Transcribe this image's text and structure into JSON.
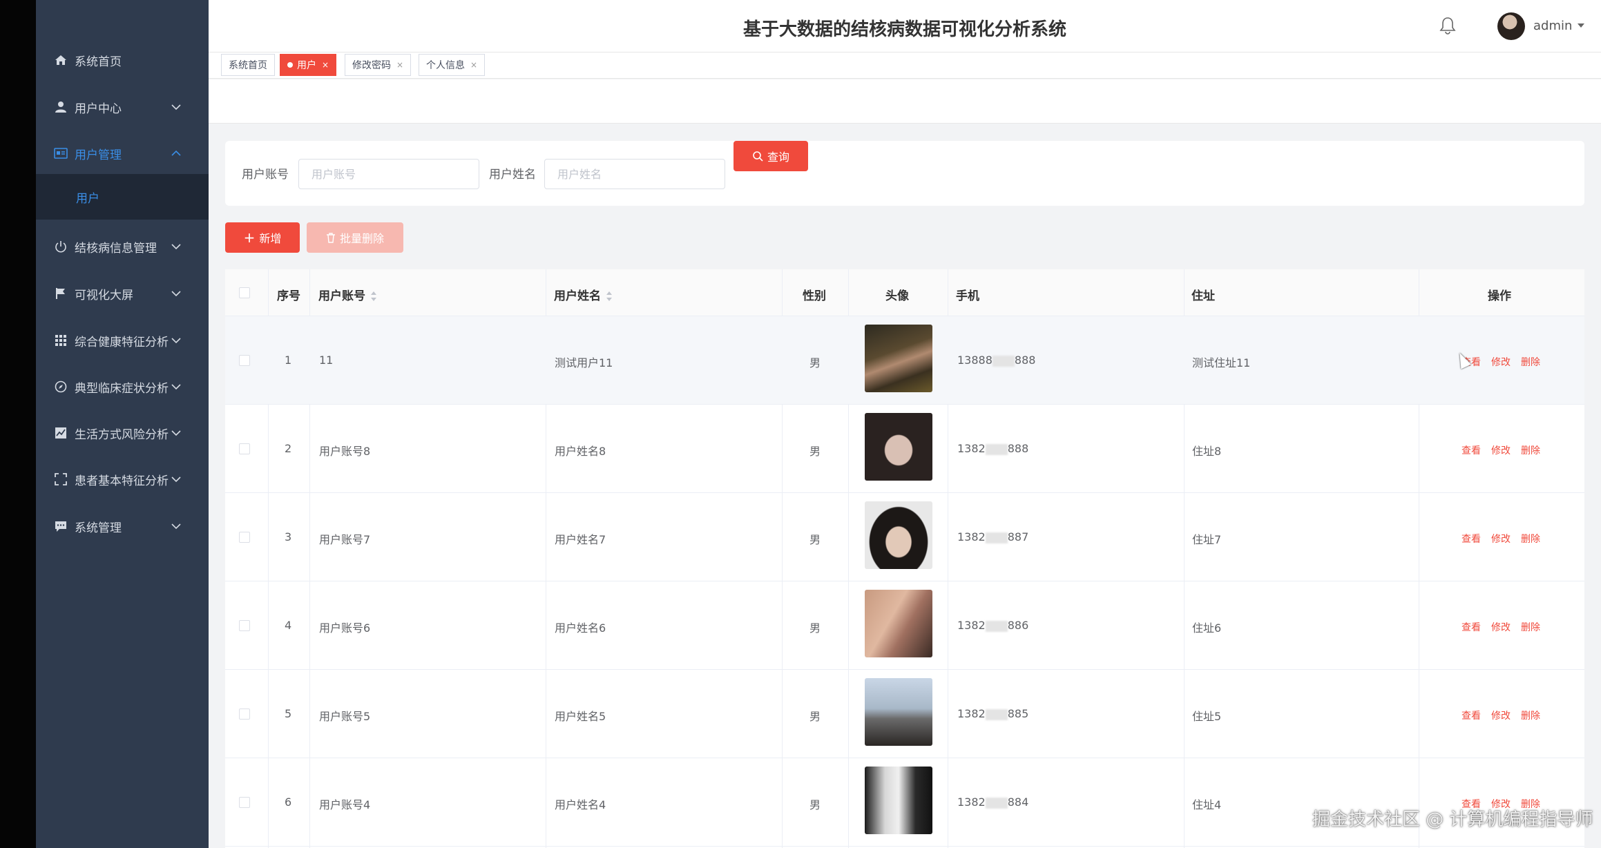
{
  "app": {
    "title": "基于大数据的结核病数据可视化分析系统",
    "user": "admin",
    "accent": "#f04a3c"
  },
  "sidebar": {
    "items": [
      {
        "label": "系统首页",
        "icon": "home-icon"
      },
      {
        "label": "用户中心",
        "icon": "user-icon"
      },
      {
        "label": "用户管理",
        "icon": "id-card-icon"
      },
      {
        "label": "结核病信息管理",
        "icon": "power-icon"
      },
      {
        "label": "可视化大屏",
        "icon": "flag-icon"
      },
      {
        "label": "综合健康特征分析",
        "icon": "grid-icon"
      },
      {
        "label": "典型临床症状分析",
        "icon": "compass-icon"
      },
      {
        "label": "生活方式风险分析",
        "icon": "chart-icon"
      },
      {
        "label": "患者基本特征分析",
        "icon": "fullscreen-icon"
      },
      {
        "label": "系统管理",
        "icon": "message-icon"
      }
    ],
    "sub_item": "用户"
  },
  "tabs": [
    {
      "label": "系统首页"
    },
    {
      "label": "用户",
      "close": "×"
    },
    {
      "label": "修改密码",
      "close": "×"
    },
    {
      "label": "个人信息",
      "close": "×"
    }
  ],
  "search": {
    "account_label": "用户账号",
    "account_placeholder": "用户账号",
    "name_label": "用户姓名",
    "name_placeholder": "用户姓名",
    "query_button": "查询"
  },
  "actions": {
    "add": "新增",
    "batch_delete": "批量删除"
  },
  "table": {
    "headers": {
      "index": "序号",
      "account": "用户账号",
      "name": "用户姓名",
      "gender": "性别",
      "avatar": "头像",
      "phone": "手机",
      "address": "住址",
      "ops": "操作"
    },
    "op_labels": {
      "view": "查看",
      "edit": "修改",
      "delete": "删除"
    },
    "rows": [
      {
        "index": "1",
        "account": "11",
        "name": "测试用户11",
        "gender": "男",
        "phone_prefix": "13888",
        "phone_suffix": "888",
        "address": "测试住址11"
      },
      {
        "index": "2",
        "account": "用户账号8",
        "name": "用户姓名8",
        "gender": "男",
        "phone_prefix": "1382",
        "phone_suffix": "888",
        "address": "住址8"
      },
      {
        "index": "3",
        "account": "用户账号7",
        "name": "用户姓名7",
        "gender": "男",
        "phone_prefix": "1382",
        "phone_suffix": "887",
        "address": "住址7"
      },
      {
        "index": "4",
        "account": "用户账号6",
        "name": "用户姓名6",
        "gender": "男",
        "phone_prefix": "1382",
        "phone_suffix": "886",
        "address": "住址6"
      },
      {
        "index": "5",
        "account": "用户账号5",
        "name": "用户姓名5",
        "gender": "男",
        "phone_prefix": "1382",
        "phone_suffix": "885",
        "address": "住址5"
      },
      {
        "index": "6",
        "account": "用户账号4",
        "name": "用户姓名4",
        "gender": "男",
        "phone_prefix": "1382",
        "phone_suffix": "884",
        "address": "住址4"
      }
    ]
  },
  "watermark": "掘金技术社区 @ 计算机编程指导师"
}
